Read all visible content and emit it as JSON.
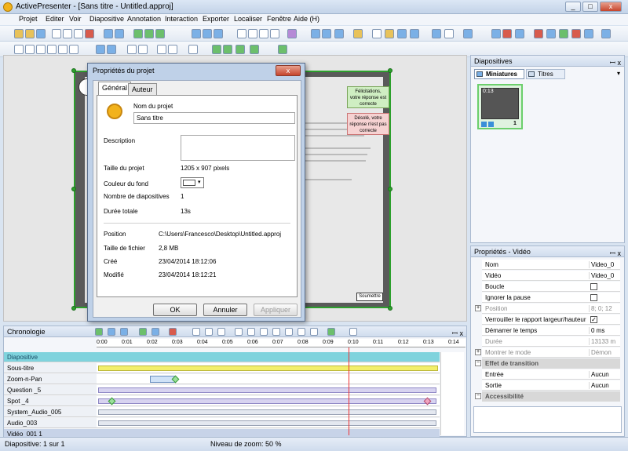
{
  "window": {
    "title": "ActivePresenter - [Sans titre  - Untitled.approj]",
    "min": "_",
    "max": "□",
    "close": "x"
  },
  "menu": [
    "Projet",
    "Editer",
    "Voir",
    "Diapositive",
    "Annotation",
    "Interaction",
    "Exporter",
    "Localiser",
    "Fenêtre",
    "Aide (H)"
  ],
  "slide": {
    "callout_correct": "Félicitations, votre réponse est correcte",
    "callout_wrong": "Désolé, votre réponse n'est pas correcte",
    "submit": "Soumettre"
  },
  "dialog": {
    "title": "Propriétés du projet",
    "close": "x",
    "tabs": [
      "Général",
      "Auteur"
    ],
    "project_name_label": "Nom du projet",
    "project_name_value": "Sans titre",
    "description_label": "Description",
    "rows1": [
      {
        "label": "Taille du projet",
        "value": "1205 x 907 pixels"
      },
      {
        "label": "Couleur du fond",
        "value": ""
      },
      {
        "label": "Nombre de diapositives",
        "value": "1"
      },
      {
        "label": "Durée totale",
        "value": "13s"
      }
    ],
    "rows2": [
      {
        "label": "Position",
        "value": "C:\\Users\\Francesco\\Desktop\\Untitled.approj"
      },
      {
        "label": "Taille de fichier",
        "value": "2,8 MB"
      },
      {
        "label": "Créé",
        "value": "23/04/2014 18:12:06"
      },
      {
        "label": "Modifié",
        "value": "23/04/2014 18:12:21"
      }
    ],
    "ok": "OK",
    "cancel": "Annuler",
    "apply": "Appliquer"
  },
  "slides_panel": {
    "title": "Diapositives",
    "pin": "ꟷ x",
    "tabs": [
      "Miniatures",
      "Titres"
    ],
    "thumb_time": "0:13",
    "thumb_number": "1"
  },
  "props_panel": {
    "title": "Propriétés  - Vidéo",
    "pin": "ꟷ x",
    "rows": [
      {
        "k": "Nom",
        "v": "Video_0"
      },
      {
        "k": "Vidéo",
        "v": "Video_0"
      },
      {
        "k": "Boucle",
        "v": ""
      },
      {
        "k": "Ignorer la pause",
        "v": ""
      },
      {
        "k": "Position",
        "v": "8; 0; 12"
      },
      {
        "k": "Verrouiller le rapport largeur/hauteur",
        "v": "✓"
      },
      {
        "k": "Démarrer le temps",
        "v": "0 ms"
      },
      {
        "k": "Durée",
        "v": "13133 m"
      },
      {
        "k": "Montrer le mode",
        "v": "Démon"
      },
      {
        "k": "Effet de transition",
        "v": ""
      },
      {
        "k": "Entrée",
        "v": "Aucun"
      },
      {
        "k": "Sortie",
        "v": "Aucun"
      },
      {
        "k": "Accessibilité",
        "v": ""
      }
    ],
    "expand": "+",
    "collapse": "−"
  },
  "timeline": {
    "title": "Chronologie",
    "pin": "ꟷ x",
    "ticks": [
      "0:00",
      "0:01",
      "0:02",
      "0:03",
      "0:04",
      "0:05",
      "0:06",
      "0:07",
      "0:08",
      "0:09",
      "0:10",
      "0:11",
      "0:12",
      "0:13",
      "0:14"
    ],
    "tracks": [
      "Diapositive",
      "Sous-titre",
      "Zoom-n-Pan",
      "Question _5",
      "Spot _4",
      "System_Audio_005",
      "Audio_003",
      "Vidéo_001 1"
    ]
  },
  "status": {
    "slide": "Diapositive: 1 sur 1",
    "zoom": "Niveau de zoom: 50 %"
  },
  "colors": {
    "accent": "#2ca02c",
    "selection": "#c7d3e8"
  }
}
